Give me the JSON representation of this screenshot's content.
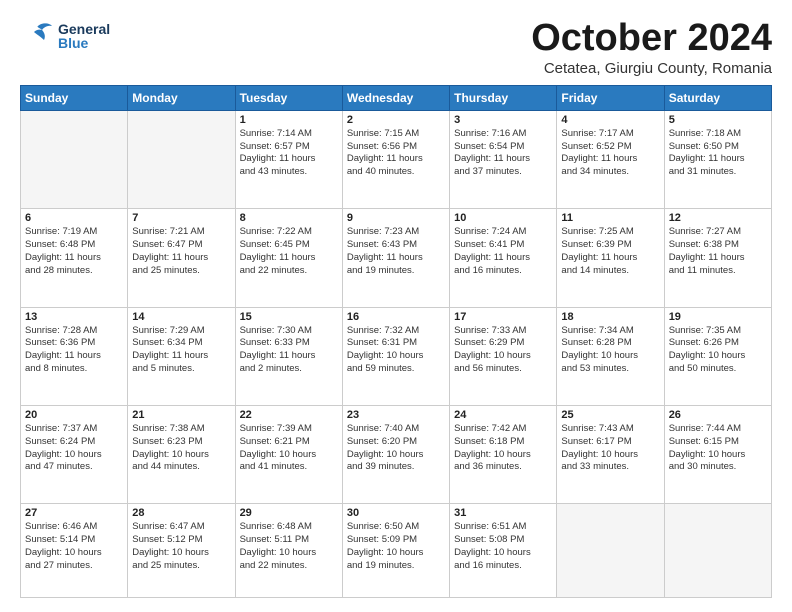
{
  "header": {
    "logo_general": "General",
    "logo_blue": "Blue",
    "month_title": "October 2024",
    "subtitle": "Cetatea, Giurgiu County, Romania"
  },
  "days_of_week": [
    "Sunday",
    "Monday",
    "Tuesday",
    "Wednesday",
    "Thursday",
    "Friday",
    "Saturday"
  ],
  "weeks": [
    [
      {
        "day": "",
        "info": ""
      },
      {
        "day": "",
        "info": ""
      },
      {
        "day": "1",
        "info": "Sunrise: 7:14 AM\nSunset: 6:57 PM\nDaylight: 11 hours\nand 43 minutes."
      },
      {
        "day": "2",
        "info": "Sunrise: 7:15 AM\nSunset: 6:56 PM\nDaylight: 11 hours\nand 40 minutes."
      },
      {
        "day": "3",
        "info": "Sunrise: 7:16 AM\nSunset: 6:54 PM\nDaylight: 11 hours\nand 37 minutes."
      },
      {
        "day": "4",
        "info": "Sunrise: 7:17 AM\nSunset: 6:52 PM\nDaylight: 11 hours\nand 34 minutes."
      },
      {
        "day": "5",
        "info": "Sunrise: 7:18 AM\nSunset: 6:50 PM\nDaylight: 11 hours\nand 31 minutes."
      }
    ],
    [
      {
        "day": "6",
        "info": "Sunrise: 7:19 AM\nSunset: 6:48 PM\nDaylight: 11 hours\nand 28 minutes."
      },
      {
        "day": "7",
        "info": "Sunrise: 7:21 AM\nSunset: 6:47 PM\nDaylight: 11 hours\nand 25 minutes."
      },
      {
        "day": "8",
        "info": "Sunrise: 7:22 AM\nSunset: 6:45 PM\nDaylight: 11 hours\nand 22 minutes."
      },
      {
        "day": "9",
        "info": "Sunrise: 7:23 AM\nSunset: 6:43 PM\nDaylight: 11 hours\nand 19 minutes."
      },
      {
        "day": "10",
        "info": "Sunrise: 7:24 AM\nSunset: 6:41 PM\nDaylight: 11 hours\nand 16 minutes."
      },
      {
        "day": "11",
        "info": "Sunrise: 7:25 AM\nSunset: 6:39 PM\nDaylight: 11 hours\nand 14 minutes."
      },
      {
        "day": "12",
        "info": "Sunrise: 7:27 AM\nSunset: 6:38 PM\nDaylight: 11 hours\nand 11 minutes."
      }
    ],
    [
      {
        "day": "13",
        "info": "Sunrise: 7:28 AM\nSunset: 6:36 PM\nDaylight: 11 hours\nand 8 minutes."
      },
      {
        "day": "14",
        "info": "Sunrise: 7:29 AM\nSunset: 6:34 PM\nDaylight: 11 hours\nand 5 minutes."
      },
      {
        "day": "15",
        "info": "Sunrise: 7:30 AM\nSunset: 6:33 PM\nDaylight: 11 hours\nand 2 minutes."
      },
      {
        "day": "16",
        "info": "Sunrise: 7:32 AM\nSunset: 6:31 PM\nDaylight: 10 hours\nand 59 minutes."
      },
      {
        "day": "17",
        "info": "Sunrise: 7:33 AM\nSunset: 6:29 PM\nDaylight: 10 hours\nand 56 minutes."
      },
      {
        "day": "18",
        "info": "Sunrise: 7:34 AM\nSunset: 6:28 PM\nDaylight: 10 hours\nand 53 minutes."
      },
      {
        "day": "19",
        "info": "Sunrise: 7:35 AM\nSunset: 6:26 PM\nDaylight: 10 hours\nand 50 minutes."
      }
    ],
    [
      {
        "day": "20",
        "info": "Sunrise: 7:37 AM\nSunset: 6:24 PM\nDaylight: 10 hours\nand 47 minutes."
      },
      {
        "day": "21",
        "info": "Sunrise: 7:38 AM\nSunset: 6:23 PM\nDaylight: 10 hours\nand 44 minutes."
      },
      {
        "day": "22",
        "info": "Sunrise: 7:39 AM\nSunset: 6:21 PM\nDaylight: 10 hours\nand 41 minutes."
      },
      {
        "day": "23",
        "info": "Sunrise: 7:40 AM\nSunset: 6:20 PM\nDaylight: 10 hours\nand 39 minutes."
      },
      {
        "day": "24",
        "info": "Sunrise: 7:42 AM\nSunset: 6:18 PM\nDaylight: 10 hours\nand 36 minutes."
      },
      {
        "day": "25",
        "info": "Sunrise: 7:43 AM\nSunset: 6:17 PM\nDaylight: 10 hours\nand 33 minutes."
      },
      {
        "day": "26",
        "info": "Sunrise: 7:44 AM\nSunset: 6:15 PM\nDaylight: 10 hours\nand 30 minutes."
      }
    ],
    [
      {
        "day": "27",
        "info": "Sunrise: 6:46 AM\nSunset: 5:14 PM\nDaylight: 10 hours\nand 27 minutes."
      },
      {
        "day": "28",
        "info": "Sunrise: 6:47 AM\nSunset: 5:12 PM\nDaylight: 10 hours\nand 25 minutes."
      },
      {
        "day": "29",
        "info": "Sunrise: 6:48 AM\nSunset: 5:11 PM\nDaylight: 10 hours\nand 22 minutes."
      },
      {
        "day": "30",
        "info": "Sunrise: 6:50 AM\nSunset: 5:09 PM\nDaylight: 10 hours\nand 19 minutes."
      },
      {
        "day": "31",
        "info": "Sunrise: 6:51 AM\nSunset: 5:08 PM\nDaylight: 10 hours\nand 16 minutes."
      },
      {
        "day": "",
        "info": ""
      },
      {
        "day": "",
        "info": ""
      }
    ]
  ]
}
